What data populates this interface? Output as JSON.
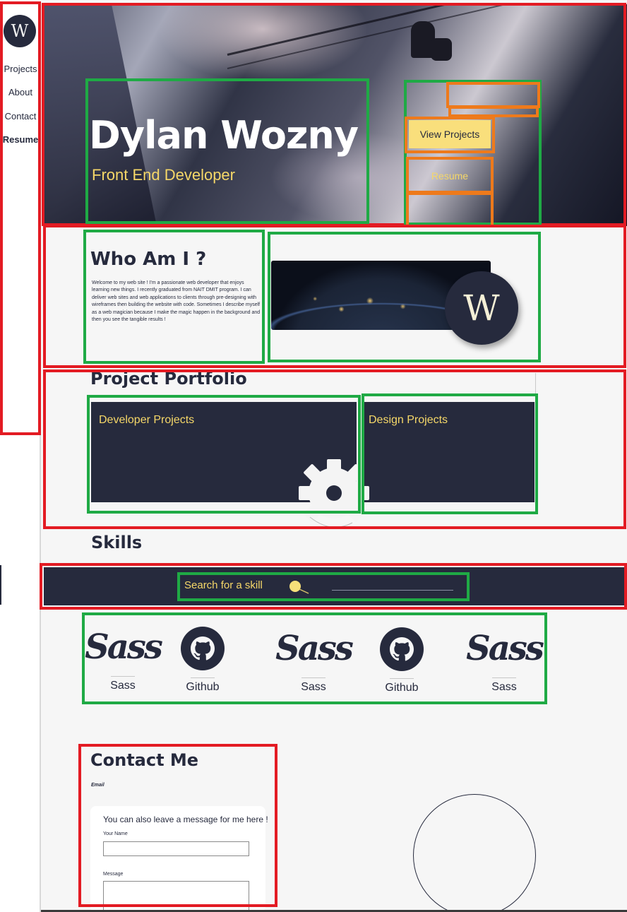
{
  "sidebar": {
    "logo_letter": "W",
    "items": [
      {
        "label": "Projects"
      },
      {
        "label": "About"
      },
      {
        "label": "Contact"
      },
      {
        "label": "Resume"
      }
    ]
  },
  "hero": {
    "title": "Dylan Wozny",
    "subtitle": "Front End Developer",
    "buttons": {
      "view_projects": "View Projects",
      "resume": "Resume"
    }
  },
  "about": {
    "title": "Who Am I ?",
    "text": "Welcome to my web site ! I'm a passionate web developer that enjoys learning new things. I recently graduated from NAIT DMIT program. I can deliver web sites and web applications to clients through pre-designing with wireframes then building the website with code. Sometimes I describe myself as a web magician because I make the magic happen in the background and then you see the tangible results !",
    "badge_letter": "W"
  },
  "portfolio": {
    "title": "Project Portfolio",
    "cards": [
      {
        "label": "Developer Projects"
      },
      {
        "label": "Design Projects"
      }
    ]
  },
  "skills": {
    "title": "Skills",
    "search_label": "Search for a skill",
    "search_value": "",
    "items": [
      {
        "label": "Sass",
        "icon": "sass-logo-icon",
        "logo_text": "Sass"
      },
      {
        "label": "Github",
        "icon": "github-icon"
      },
      {
        "label": "Sass",
        "icon": "sass-logo-icon",
        "logo_text": "Sass"
      },
      {
        "label": "Github",
        "icon": "github-icon"
      },
      {
        "label": "Sass",
        "icon": "sass-logo-icon",
        "logo_text": "Sass"
      }
    ]
  },
  "contact": {
    "title": "Contact Me",
    "email_label": "Email",
    "form_heading": "You can also leave a message for me here !",
    "name_label": "Your Name",
    "name_value": "",
    "message_label": "Message",
    "message_value": ""
  },
  "colors": {
    "navy": "#262a3d",
    "accent_yellow": "#f5d768",
    "button_yellow": "#f9df7c",
    "annotation_red": "#e31b23",
    "annotation_green": "#1faa45",
    "annotation_orange": "#ee7a1b"
  }
}
